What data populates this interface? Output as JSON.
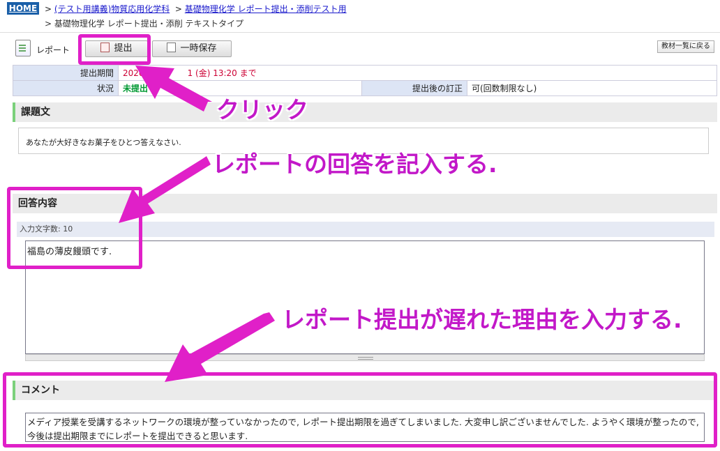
{
  "breadcrumb": {
    "home": "HOME",
    "sep": ">",
    "course": "(テスト用講義)物質応用化学科",
    "subject": "基礎物理化学 レポート提出・添削テスト用",
    "current": "基礎物理化学 レポート提出・添削 テキストタイプ"
  },
  "toolbar": {
    "report_label": "レポート",
    "submit_label": "提出",
    "save_label": "一時保存",
    "back_label": "教材一覧に戻る"
  },
  "info": {
    "period_label": "提出期間",
    "period_value_a": "2020/",
    "period_value_b": "1 (金) 13:20 まで",
    "status_label": "状況",
    "status_value": "未提出",
    "revision_label": "提出後の訂正",
    "revision_value": "可(回数制限なし)"
  },
  "task": {
    "heading": "課題文",
    "text": "あなたが大好きなお菓子をひとつ答えなさい."
  },
  "answer": {
    "heading": "回答内容",
    "char_count": "入力文字数: 10",
    "value": "福島の薄皮饅頭です."
  },
  "comment": {
    "heading": "コメント",
    "value": "メディア授業を受講するネットワークの環境が整っていなかったので, レポート提出期限を過ぎてしまいました. 大変申し訳ございませんでした. ようやく環境が整ったので, 今後は提出期限までにレポートを提出できると思います."
  },
  "annotations": {
    "click": "クリック",
    "answer_hint": "レポートの回答を記入する.",
    "comment_hint": "レポート提出が遅れた理由を入力する.",
    "color": "#e020c8"
  }
}
